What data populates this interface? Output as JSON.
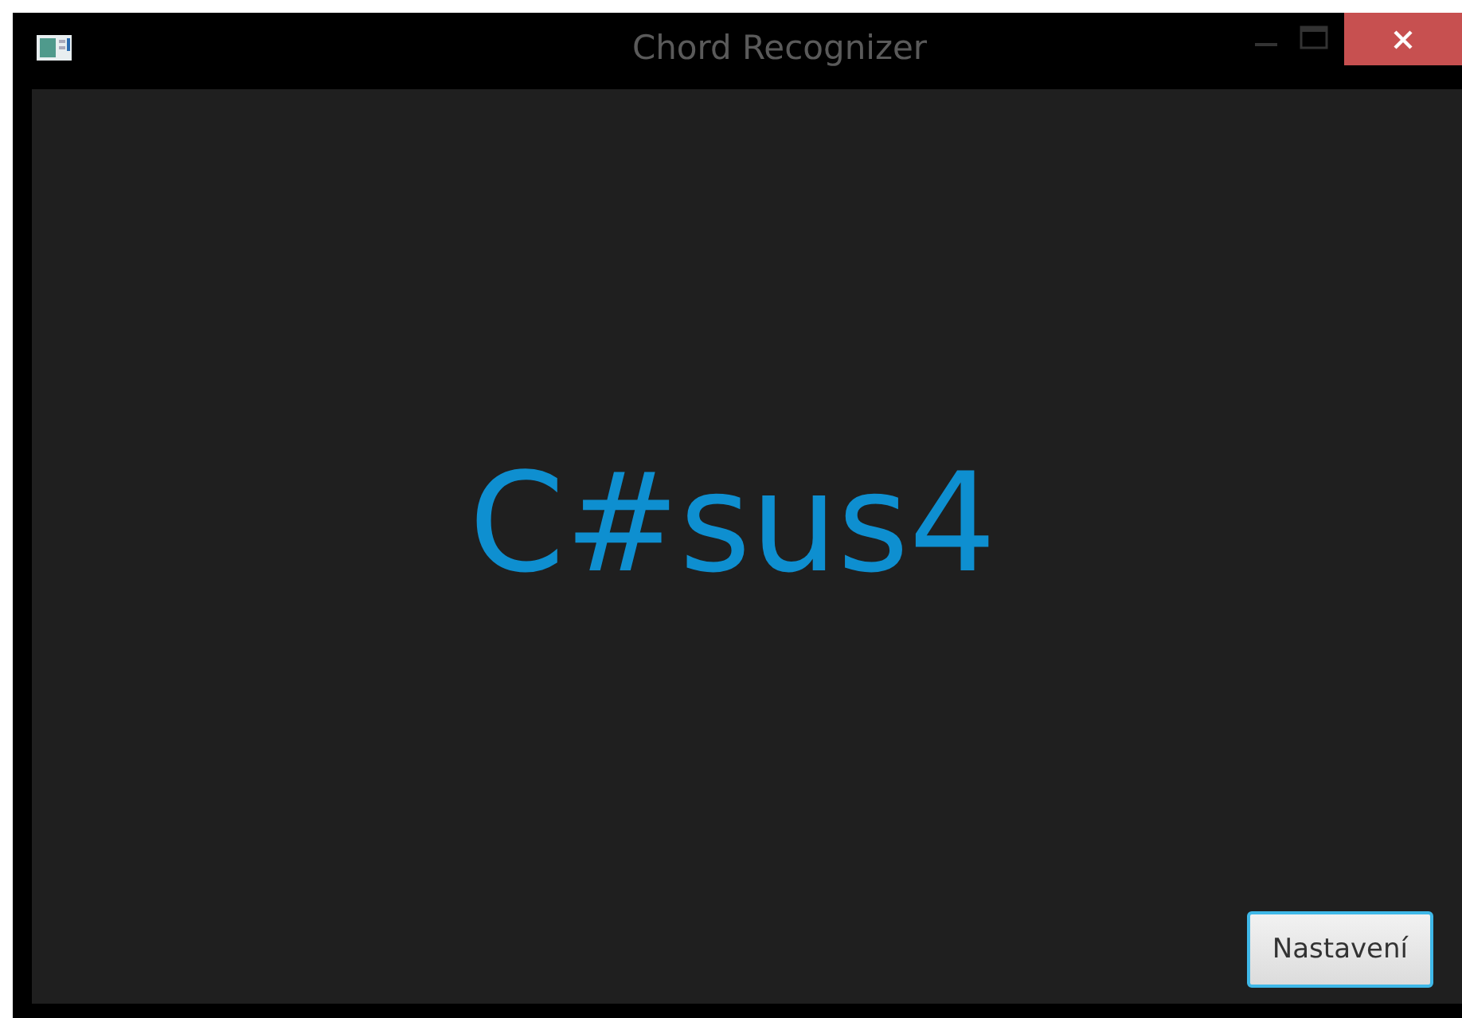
{
  "window": {
    "title": "Chord Recognizer"
  },
  "chord": "C#sus4",
  "buttons": [
    {
      "label": "Nastavení"
    }
  ]
}
